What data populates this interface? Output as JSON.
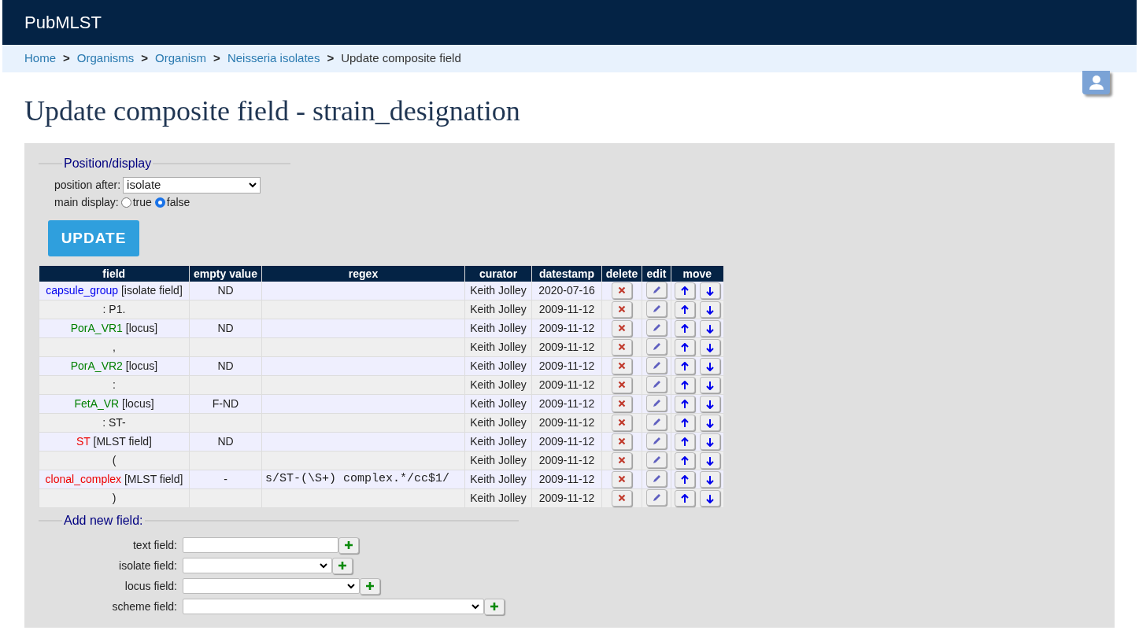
{
  "header": {
    "title": "PubMLST"
  },
  "breadcrumbs": [
    {
      "label": "Home",
      "link": true
    },
    {
      "label": "Organisms",
      "link": true
    },
    {
      "label": "Organism",
      "link": true
    },
    {
      "label": "Neisseria isolates",
      "link": true
    },
    {
      "label": "Update composite field",
      "link": false
    }
  ],
  "breadcrumb_separator": ">",
  "page_title": "Update composite field - strain_designation",
  "position_display": {
    "legend": "Position/display",
    "position_label": "position after:",
    "position_value": "isolate",
    "main_display_label": "main display:",
    "options": [
      {
        "label": "true",
        "selected": false
      },
      {
        "label": "false",
        "selected": true
      }
    ],
    "update_button": "UPDATE"
  },
  "table": {
    "columns": [
      "field",
      "empty value",
      "regex",
      "curator",
      "datestamp",
      "delete",
      "edit",
      "move"
    ],
    "rows": [
      {
        "field": {
          "kind": "isolate",
          "name": "capsule_group",
          "tag": "[isolate field]"
        },
        "empty_value": "ND",
        "regex": "",
        "curator": "Keith Jolley",
        "datestamp": "2020-07-16"
      },
      {
        "field": {
          "kind": "text",
          "name": ": P1."
        },
        "empty_value": "",
        "regex": "",
        "curator": "Keith Jolley",
        "datestamp": "2009-11-12"
      },
      {
        "field": {
          "kind": "locus",
          "name": "PorA_VR1",
          "tag": "[locus]"
        },
        "empty_value": "ND",
        "regex": "",
        "curator": "Keith Jolley",
        "datestamp": "2009-11-12"
      },
      {
        "field": {
          "kind": "text",
          "name": ","
        },
        "empty_value": "",
        "regex": "",
        "curator": "Keith Jolley",
        "datestamp": "2009-11-12"
      },
      {
        "field": {
          "kind": "locus",
          "name": "PorA_VR2",
          "tag": "[locus]"
        },
        "empty_value": "ND",
        "regex": "",
        "curator": "Keith Jolley",
        "datestamp": "2009-11-12"
      },
      {
        "field": {
          "kind": "text",
          "name": ":"
        },
        "empty_value": "",
        "regex": "",
        "curator": "Keith Jolley",
        "datestamp": "2009-11-12"
      },
      {
        "field": {
          "kind": "locus",
          "name": "FetA_VR",
          "tag": "[locus]"
        },
        "empty_value": "F-ND",
        "regex": "",
        "curator": "Keith Jolley",
        "datestamp": "2009-11-12"
      },
      {
        "field": {
          "kind": "text",
          "name": ": ST-"
        },
        "empty_value": "",
        "regex": "",
        "curator": "Keith Jolley",
        "datestamp": "2009-11-12"
      },
      {
        "field": {
          "kind": "mlst",
          "name": "ST",
          "tag": "[MLST field]"
        },
        "empty_value": "ND",
        "regex": "",
        "curator": "Keith Jolley",
        "datestamp": "2009-11-12"
      },
      {
        "field": {
          "kind": "text",
          "name": "("
        },
        "empty_value": "",
        "regex": "",
        "curator": "Keith Jolley",
        "datestamp": "2009-11-12"
      },
      {
        "field": {
          "kind": "mlst",
          "name": "clonal_complex",
          "tag": "[MLST field]"
        },
        "empty_value": "-",
        "regex": "s/ST-(\\S+) complex.*/cc$1/",
        "curator": "Keith Jolley",
        "datestamp": "2009-11-12"
      },
      {
        "field": {
          "kind": "text",
          "name": ")"
        },
        "empty_value": "",
        "regex": "",
        "curator": "Keith Jolley",
        "datestamp": "2009-11-12"
      }
    ]
  },
  "add_new_field": {
    "legend": "Add new field:",
    "rows": [
      {
        "kind": "text",
        "label": "text field:"
      },
      {
        "kind": "select",
        "label": "isolate field:"
      },
      {
        "kind": "select",
        "label": "locus field:"
      },
      {
        "kind": "select",
        "label": "scheme field:"
      }
    ]
  }
}
